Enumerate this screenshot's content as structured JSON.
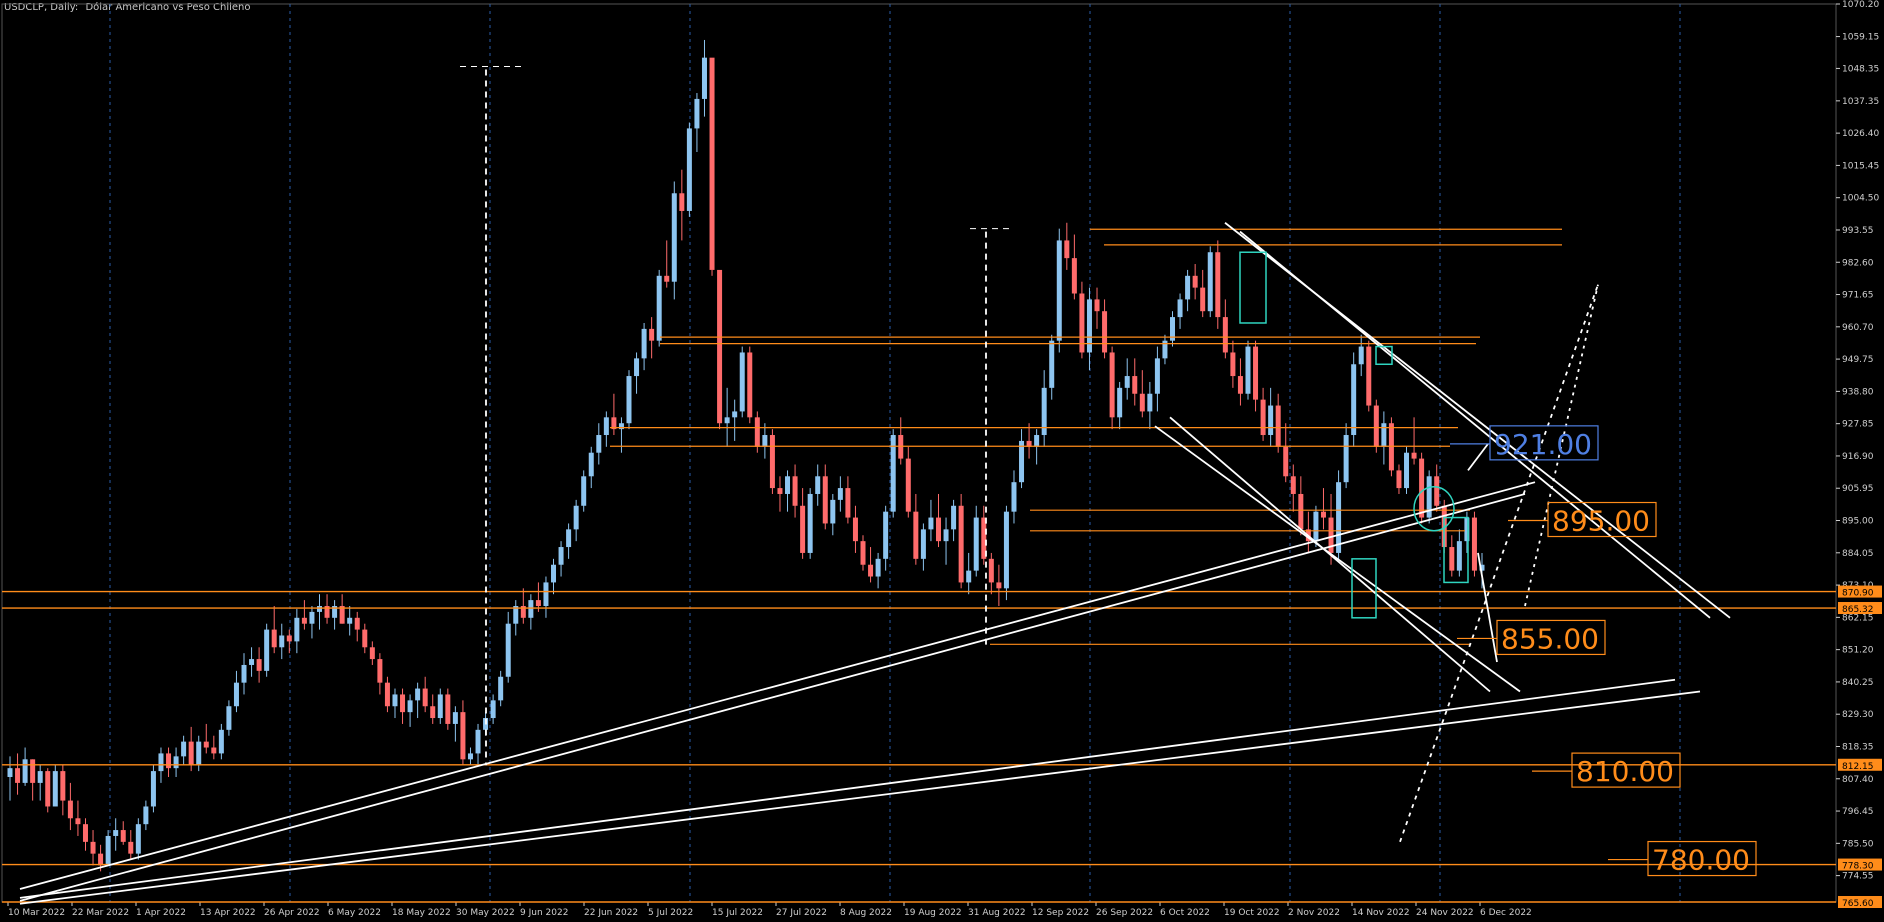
{
  "header": {
    "symbol": "USDCLP, Daily:",
    "description": "Dólar Americano vs Peso Chileno"
  },
  "colors": {
    "background": "#000000",
    "axis": "#cfcfcf",
    "bull": "#8ec5f0",
    "bear": "#ff6b6b",
    "level": "#ff8c1a",
    "trend": "#ffffff",
    "box": "#2fd5c0",
    "label_blue": "#4f7fe3"
  },
  "chart_data": {
    "type": "candlestick",
    "symbol": "USDCLP",
    "timeframe": "Daily",
    "ylim": [
      765.6,
      1070.2
    ],
    "y_ticks": [
      1070.2,
      1059.15,
      1048.35,
      1037.35,
      1026.4,
      1015.45,
      1004.5,
      993.55,
      982.6,
      971.65,
      960.7,
      949.75,
      938.8,
      927.85,
      916.9,
      905.95,
      895.0,
      884.05,
      873.1,
      862.15,
      851.2,
      840.25,
      829.3,
      818.35,
      807.4,
      796.45,
      785.5,
      774.55
    ],
    "x_ticks": [
      "10 Mar 2022",
      "22 Mar 2022",
      "1 Apr 2022",
      "13 Apr 2022",
      "26 Apr 2022",
      "6 May 2022",
      "18 May 2022",
      "30 May 2022",
      "9 Jun 2022",
      "22 Jun 2022",
      "5 Jul 2022",
      "15 Jul 2022",
      "27 Jul 2022",
      "8 Aug 2022",
      "19 Aug 2022",
      "31 Aug 2022",
      "12 Sep 2022",
      "26 Sep 2022",
      "6 Oct 2022",
      "19 Oct 2022",
      "2 Nov 2022",
      "14 Nov 2022",
      "24 Nov 2022",
      "6 Dec 2022"
    ],
    "axis_price_labels": [
      "870.90",
      "865.32",
      "812.15",
      "778.30",
      "765.60"
    ],
    "annotations": [
      {
        "text": "921.00",
        "price": 921.0,
        "style": "blue"
      },
      {
        "text": "895.00",
        "price": 895.0,
        "style": "orange"
      },
      {
        "text": "855.00",
        "price": 855.0,
        "style": "orange"
      },
      {
        "text": "810.00",
        "price": 810.0,
        "style": "orange"
      },
      {
        "text": "780.00",
        "price": 780.0,
        "style": "orange"
      }
    ],
    "candles": [
      [
        808,
        815,
        800,
        811
      ],
      [
        811,
        816,
        802,
        806
      ],
      [
        806,
        818,
        805,
        814
      ],
      [
        814,
        814,
        800,
        806
      ],
      [
        806,
        812,
        800,
        810
      ],
      [
        810,
        811,
        796,
        798
      ],
      [
        798,
        812,
        798,
        810
      ],
      [
        810,
        812,
        795,
        800
      ],
      [
        800,
        806,
        790,
        794
      ],
      [
        794,
        800,
        788,
        792
      ],
      [
        792,
        794,
        783,
        786
      ],
      [
        786,
        790,
        778,
        782
      ],
      [
        782,
        785,
        776,
        778
      ],
      [
        778,
        790,
        778,
        788
      ],
      [
        788,
        794,
        783,
        790
      ],
      [
        790,
        793,
        785,
        786
      ],
      [
        786,
        790,
        780,
        782
      ],
      [
        782,
        794,
        780,
        792
      ],
      [
        792,
        800,
        790,
        798
      ],
      [
        798,
        812,
        796,
        810
      ],
      [
        810,
        818,
        806,
        816
      ],
      [
        816,
        818,
        808,
        811
      ],
      [
        811,
        818,
        808,
        815
      ],
      [
        815,
        822,
        812,
        820
      ],
      [
        820,
        825,
        810,
        812
      ],
      [
        812,
        822,
        810,
        820
      ],
      [
        820,
        826,
        816,
        818
      ],
      [
        818,
        822,
        814,
        816
      ],
      [
        816,
        826,
        814,
        824
      ],
      [
        824,
        834,
        822,
        832
      ],
      [
        832,
        844,
        830,
        840
      ],
      [
        840,
        850,
        836,
        846
      ],
      [
        846,
        852,
        842,
        848
      ],
      [
        848,
        852,
        840,
        844
      ],
      [
        844,
        860,
        842,
        858
      ],
      [
        858,
        866,
        850,
        852
      ],
      [
        852,
        860,
        848,
        856
      ],
      [
        856,
        858,
        850,
        854
      ],
      [
        854,
        865,
        850,
        862
      ],
      [
        862,
        868,
        858,
        860
      ],
      [
        860,
        866,
        855,
        864
      ],
      [
        864,
        870,
        858,
        866
      ],
      [
        866,
        870,
        860,
        862
      ],
      [
        862,
        868,
        858,
        866
      ],
      [
        866,
        870,
        860,
        860
      ],
      [
        860,
        866,
        856,
        862
      ],
      [
        862,
        864,
        854,
        858
      ],
      [
        858,
        860,
        850,
        852
      ],
      [
        852,
        854,
        846,
        848
      ],
      [
        848,
        850,
        836,
        840
      ],
      [
        840,
        842,
        830,
        832
      ],
      [
        832,
        838,
        828,
        836
      ],
      [
        836,
        838,
        826,
        830
      ],
      [
        830,
        836,
        825,
        834
      ],
      [
        834,
        840,
        828,
        838
      ],
      [
        838,
        842,
        830,
        832
      ],
      [
        832,
        836,
        826,
        828
      ],
      [
        828,
        838,
        826,
        836
      ],
      [
        836,
        838,
        824,
        826
      ],
      [
        826,
        832,
        820,
        830
      ],
      [
        830,
        834,
        812,
        814
      ],
      [
        814,
        818,
        812,
        816
      ],
      [
        816,
        826,
        812,
        824
      ],
      [
        824,
        830,
        822,
        828
      ],
      [
        828,
        836,
        826,
        834
      ],
      [
        834,
        844,
        832,
        842
      ],
      [
        842,
        864,
        840,
        860
      ],
      [
        860,
        868,
        856,
        866
      ],
      [
        866,
        872,
        860,
        862
      ],
      [
        862,
        870,
        858,
        868
      ],
      [
        868,
        874,
        864,
        866
      ],
      [
        866,
        876,
        862,
        874
      ],
      [
        874,
        882,
        870,
        880
      ],
      [
        880,
        888,
        876,
        886
      ],
      [
        886,
        894,
        882,
        892
      ],
      [
        892,
        902,
        888,
        900
      ],
      [
        900,
        912,
        898,
        910
      ],
      [
        910,
        920,
        906,
        918
      ],
      [
        918,
        928,
        914,
        924
      ],
      [
        924,
        932,
        920,
        930
      ],
      [
        930,
        938,
        924,
        926
      ],
      [
        926,
        930,
        918,
        928
      ],
      [
        928,
        946,
        926,
        944
      ],
      [
        944,
        952,
        938,
        950
      ],
      [
        950,
        962,
        946,
        960
      ],
      [
        960,
        964,
        950,
        956
      ],
      [
        956,
        980,
        954,
        978
      ],
      [
        978,
        990,
        974,
        976
      ],
      [
        976,
        1010,
        970,
        1006
      ],
      [
        1006,
        1014,
        990,
        1000
      ],
      [
        1000,
        1030,
        998,
        1028
      ],
      [
        1028,
        1040,
        1020,
        1038
      ],
      [
        1038,
        1058,
        1032,
        1052
      ],
      [
        1052,
        980,
        978,
        980
      ],
      [
        980,
        960,
        926,
        928
      ],
      [
        928,
        940,
        920,
        930
      ],
      [
        930,
        936,
        922,
        932
      ],
      [
        932,
        954,
        930,
        952
      ],
      [
        952,
        954,
        928,
        930
      ],
      [
        930,
        932,
        918,
        920
      ],
      [
        920,
        928,
        916,
        924
      ],
      [
        924,
        926,
        904,
        906
      ],
      [
        906,
        910,
        898,
        904
      ],
      [
        904,
        912,
        898,
        910
      ],
      [
        910,
        914,
        896,
        900
      ],
      [
        900,
        906,
        882,
        884
      ],
      [
        884,
        906,
        882,
        904
      ],
      [
        904,
        914,
        900,
        910
      ],
      [
        910,
        914,
        892,
        894
      ],
      [
        894,
        904,
        890,
        902
      ],
      [
        902,
        910,
        898,
        906
      ],
      [
        906,
        910,
        894,
        896
      ],
      [
        896,
        900,
        884,
        888
      ],
      [
        888,
        890,
        878,
        880
      ],
      [
        880,
        886,
        874,
        876
      ],
      [
        876,
        884,
        872,
        882
      ],
      [
        882,
        900,
        878,
        898
      ],
      [
        898,
        926,
        896,
        924
      ],
      [
        924,
        930,
        914,
        916
      ],
      [
        916,
        920,
        896,
        898
      ],
      [
        898,
        904,
        880,
        882
      ],
      [
        882,
        894,
        878,
        892
      ],
      [
        892,
        902,
        888,
        896
      ],
      [
        896,
        904,
        886,
        888
      ],
      [
        888,
        896,
        880,
        892
      ],
      [
        892,
        902,
        888,
        900
      ],
      [
        900,
        904,
        872,
        874
      ],
      [
        874,
        884,
        870,
        878
      ],
      [
        878,
        900,
        876,
        896
      ],
      [
        896,
        900,
        880,
        882
      ],
      [
        882,
        884,
        870,
        874
      ],
      [
        874,
        880,
        866,
        872
      ],
      [
        872,
        900,
        868,
        898
      ],
      [
        898,
        912,
        894,
        908
      ],
      [
        908,
        926,
        906,
        922
      ],
      [
        922,
        928,
        916,
        920
      ],
      [
        920,
        926,
        914,
        924
      ],
      [
        924,
        946,
        920,
        940
      ],
      [
        940,
        958,
        936,
        956
      ],
      [
        956,
        994,
        952,
        990
      ],
      [
        990,
        996,
        980,
        984
      ],
      [
        984,
        992,
        970,
        972
      ],
      [
        972,
        976,
        950,
        952
      ],
      [
        952,
        974,
        946,
        970
      ],
      [
        970,
        974,
        960,
        966
      ],
      [
        966,
        970,
        950,
        952
      ],
      [
        952,
        954,
        926,
        930
      ],
      [
        930,
        942,
        926,
        940
      ],
      [
        940,
        950,
        936,
        944
      ],
      [
        944,
        950,
        934,
        938
      ],
      [
        938,
        946,
        930,
        932
      ],
      [
        932,
        942,
        926,
        938
      ],
      [
        938,
        954,
        932,
        950
      ],
      [
        950,
        958,
        948,
        956
      ],
      [
        956,
        966,
        954,
        964
      ],
      [
        964,
        972,
        960,
        970
      ],
      [
        970,
        980,
        966,
        978
      ],
      [
        978,
        982,
        970,
        974
      ],
      [
        974,
        980,
        964,
        966
      ],
      [
        966,
        988,
        964,
        986
      ],
      [
        986,
        990,
        960,
        964
      ],
      [
        964,
        970,
        950,
        952
      ],
      [
        952,
        956,
        940,
        944
      ],
      [
        944,
        950,
        934,
        938
      ],
      [
        938,
        956,
        936,
        954
      ],
      [
        954,
        956,
        932,
        936
      ],
      [
        936,
        940,
        922,
        924
      ],
      [
        924,
        940,
        920,
        934
      ],
      [
        934,
        938,
        918,
        920
      ],
      [
        920,
        928,
        908,
        910
      ],
      [
        910,
        914,
        898,
        904
      ],
      [
        904,
        910,
        890,
        892
      ],
      [
        892,
        898,
        884,
        888
      ],
      [
        888,
        900,
        886,
        898
      ],
      [
        898,
        906,
        892,
        896
      ],
      [
        896,
        904,
        880,
        884
      ],
      [
        884,
        912,
        882,
        908
      ],
      [
        908,
        928,
        906,
        924
      ],
      [
        924,
        952,
        920,
        948
      ],
      [
        948,
        958,
        944,
        954
      ],
      [
        954,
        956,
        932,
        934
      ],
      [
        934,
        936,
        918,
        920
      ],
      [
        920,
        932,
        914,
        928
      ],
      [
        928,
        930,
        910,
        912
      ],
      [
        912,
        914,
        904,
        906
      ],
      [
        906,
        920,
        904,
        918
      ],
      [
        918,
        930,
        914,
        916
      ],
      [
        916,
        918,
        894,
        896
      ],
      [
        896,
        912,
        894,
        910
      ],
      [
        910,
        914,
        898,
        900
      ],
      [
        900,
        902,
        884,
        886
      ],
      [
        886,
        890,
        876,
        878
      ],
      [
        878,
        892,
        876,
        888
      ],
      [
        888,
        898,
        884,
        896
      ],
      [
        896,
        898,
        876,
        878
      ],
      [
        878,
        884,
        872,
        880
      ]
    ]
  }
}
